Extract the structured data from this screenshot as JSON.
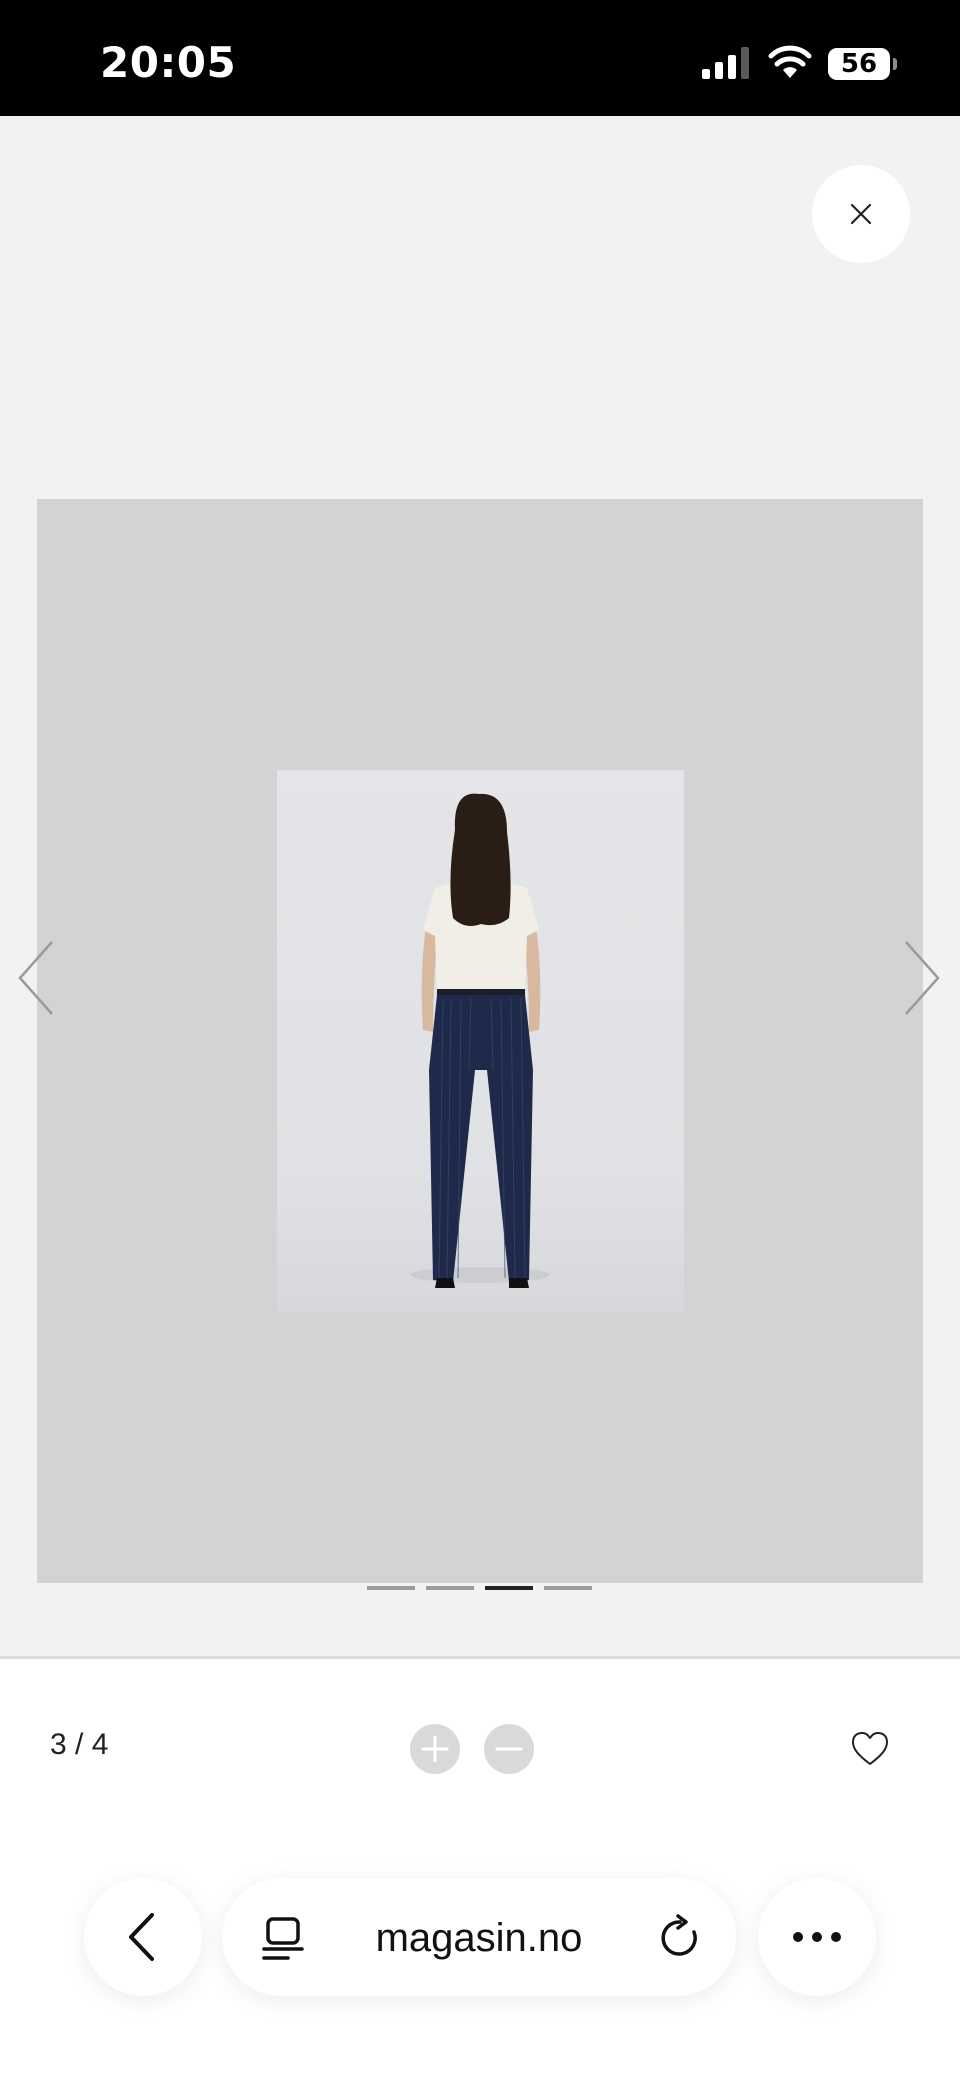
{
  "status_bar": {
    "time": "20:05",
    "battery_level": "56"
  },
  "viewer": {
    "image_alt": "Model wearing white tee and navy pinstripe trousers, back view",
    "indicators": {
      "count": 4,
      "active_index": 2
    }
  },
  "toolbar": {
    "counter": "3 / 4"
  },
  "browser": {
    "url": "magasin.no"
  },
  "icons": {
    "close": "close-icon",
    "prev": "chevron-left-icon",
    "next": "chevron-right-icon",
    "zoom_in": "plus-icon",
    "zoom_out": "minus-icon",
    "favorite": "heart-icon",
    "back": "chevron-left-icon",
    "tabs": "tabs-icon",
    "reload": "reload-icon",
    "more": "ellipsis-icon"
  },
  "colors": {
    "frame": "#d3d3d3",
    "background": "#f2f2f2",
    "indicator_active": "#222222",
    "indicator_inactive": "#9c9c9c"
  }
}
